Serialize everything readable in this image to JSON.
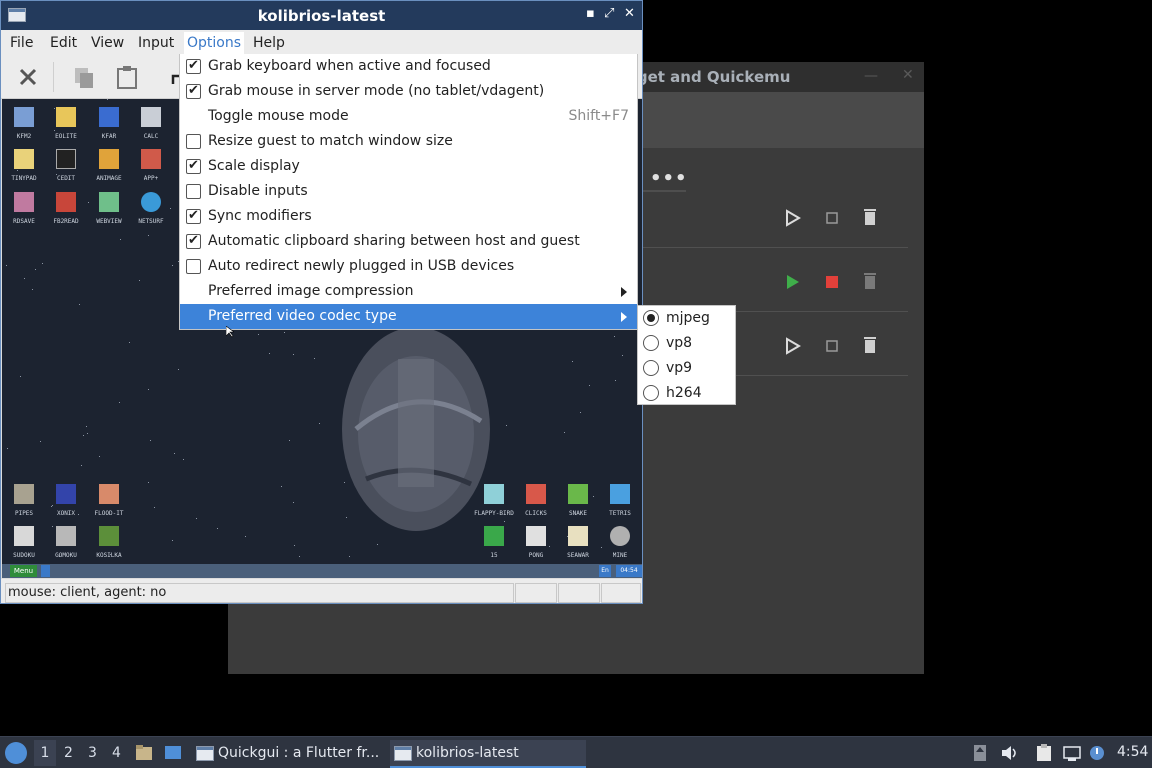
{
  "background_window": {
    "title": "ckget and Quickemu",
    "more_label": "•••",
    "vms": [
      {
        "state": "stopped"
      },
      {
        "state": "running"
      },
      {
        "state": "stopped"
      }
    ]
  },
  "kolibri_window": {
    "title": "kolibrios-latest",
    "menubar": [
      "File",
      "Edit",
      "View",
      "Input",
      "Options",
      "Help"
    ],
    "desktop_icons_top": [
      [
        "KFM2",
        "EOLITE",
        "KFAR",
        "CALC"
      ],
      [
        "TINYPAD",
        "CEDIT",
        "ANIMAGE",
        "APP+"
      ],
      [
        "RDSAVE",
        "FB2READ",
        "WEBVIEW",
        "NETSURF"
      ]
    ],
    "desktop_icons_bottom_left": [
      [
        "PIPES",
        "XONIX",
        "FLOOD-IT"
      ],
      [
        "SUDOKU",
        "GOMOKU",
        "KOSILKA"
      ]
    ],
    "desktop_icons_bottom_right": [
      [
        "FLAPPY-BIRD",
        "CLICKS",
        "SNAKE",
        "TETRIS"
      ],
      [
        "15",
        "PONG",
        "SEAWAR",
        "MINE"
      ]
    ],
    "taskbar": {
      "menu": "Menu",
      "lang": "En",
      "clock": "04:54"
    },
    "status": "mouse: client, agent:  no"
  },
  "options_menu": {
    "items": [
      {
        "label": "Grab keyboard when active and focused",
        "type": "check",
        "checked": true
      },
      {
        "label": "Grab mouse in server mode (no tablet/vdagent)",
        "type": "check",
        "checked": true
      },
      {
        "label": "Toggle mouse mode",
        "type": "action",
        "shortcut": "Shift+F7"
      },
      {
        "label": "Resize guest to match window size",
        "type": "check",
        "checked": false
      },
      {
        "label": "Scale display",
        "type": "check",
        "checked": true
      },
      {
        "label": "Disable inputs",
        "type": "check",
        "checked": false
      },
      {
        "label": "Sync modifiers",
        "type": "check",
        "checked": true
      },
      {
        "label": "Automatic clipboard sharing between host and guest",
        "type": "check",
        "checked": true
      },
      {
        "label": "Auto redirect newly plugged in USB devices",
        "type": "check",
        "checked": false
      },
      {
        "label": "Preferred image compression",
        "type": "submenu"
      },
      {
        "label": "Preferred video codec type",
        "type": "submenu",
        "highlighted": true
      }
    ]
  },
  "codec_menu": {
    "options": [
      "mjpeg",
      "vp8",
      "vp9",
      "h264"
    ],
    "selected": "mjpeg"
  },
  "panel": {
    "workspaces": [
      "1",
      "2",
      "3",
      "4"
    ],
    "active_workspace": "1",
    "tasks": [
      "Quickgui : a Flutter fr...",
      "kolibrios-latest"
    ],
    "active_task": "kolibrios-latest",
    "clock": "4:54"
  }
}
